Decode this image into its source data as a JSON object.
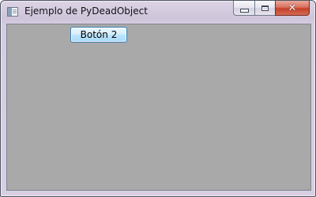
{
  "window": {
    "title": "Ejemplo de PyDeadObject",
    "icon": "app-window-icon"
  },
  "caption_buttons": {
    "minimize_icon": "minimize-icon",
    "maximize_icon": "maximize-icon",
    "close_icon": "close-icon",
    "close_glyph": "✕"
  },
  "client": {
    "background": "#a9a9a9",
    "button_label": "Botón 2"
  }
}
